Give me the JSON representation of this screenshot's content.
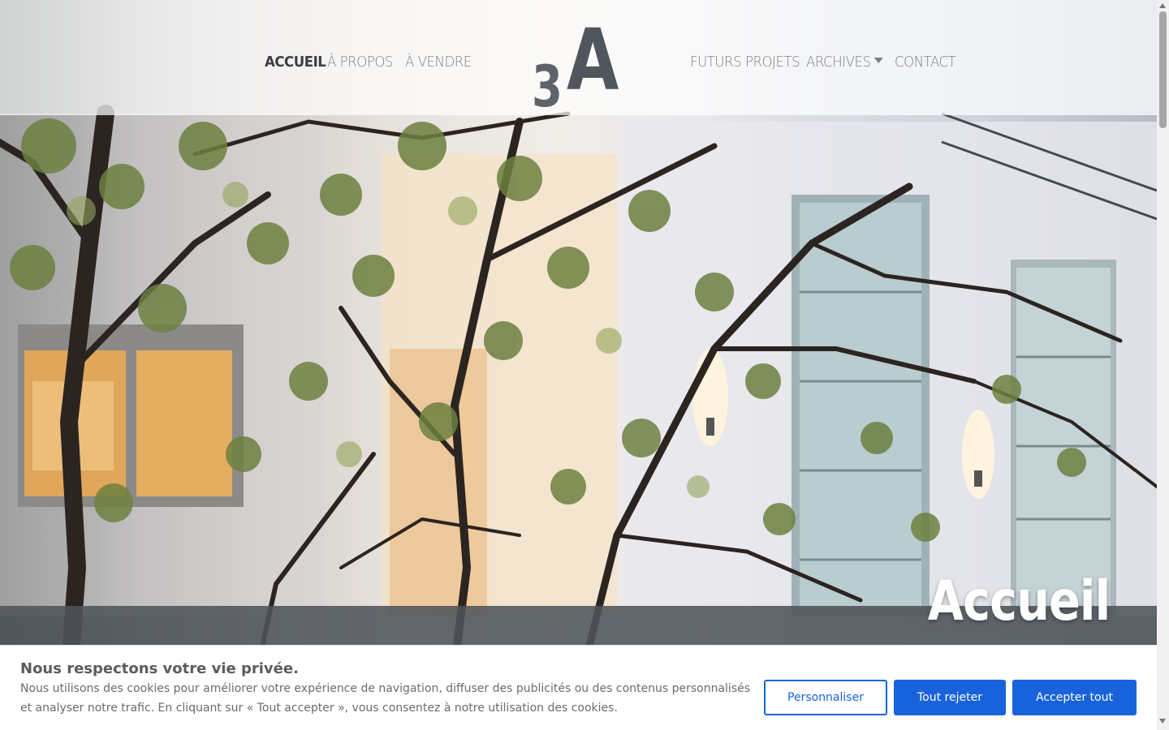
{
  "nav": {
    "left": [
      {
        "label": "Accueil",
        "active": true
      },
      {
        "label": "À propos",
        "active": false
      },
      {
        "label": "À vendre",
        "active": false
      }
    ],
    "right": [
      {
        "label": "Futurs projets"
      },
      {
        "label": "Archives",
        "has_dropdown": true
      },
      {
        "label": "Contact"
      }
    ]
  },
  "logo": {
    "three": "3",
    "a": "A"
  },
  "hero": {
    "title": "Accueil"
  },
  "cookie": {
    "title": "Nous respectons votre vie privée.",
    "text": "Nous utilisons des cookies pour améliorer votre expérience de navigation, diffuser des publicités ou des contenus personnalisés et analyser notre trafic. En cliquant sur « Tout accepter », vous consentez à notre utilisation des cookies.",
    "buttons": {
      "customize": "Personnaliser",
      "reject": "Tout rejeter",
      "accept": "Accepter tout"
    },
    "accent_color": "#1863dc"
  },
  "icons": [
    "chevron-down-icon",
    "scroll-up-arrow-icon",
    "scroll-down-arrow-icon"
  ]
}
